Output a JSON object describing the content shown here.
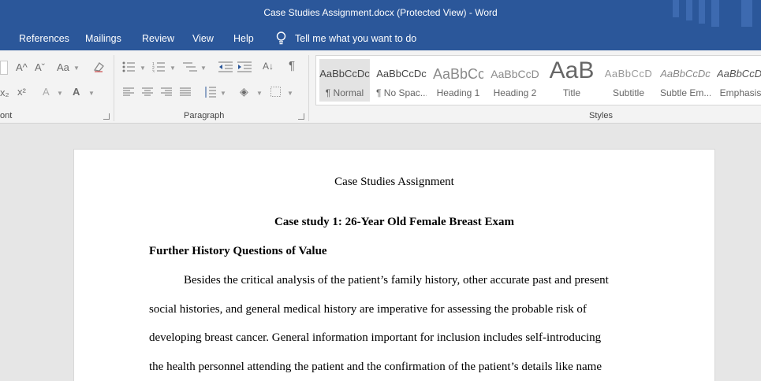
{
  "window": {
    "title": "Case Studies Assignment.docx (Protected View)  -  Word"
  },
  "tabs": [
    "References",
    "Mailings",
    "Review",
    "View",
    "Help"
  ],
  "tell_me": "Tell me what you want to do",
  "ribbon": {
    "font_group_label": "ont",
    "paragraph_group_label": "Paragraph",
    "styles_group_label": "Styles",
    "font_buttons": [
      "A^",
      "Aˇ",
      "Aa",
      "x₂",
      "x²",
      "A",
      "A"
    ],
    "styles": [
      {
        "sample": "AaBbCcDc",
        "label": "¶ Normal"
      },
      {
        "sample": "AaBbCcDc",
        "label": "¶ No Spac..."
      },
      {
        "sample": "AaBbCc",
        "label": "Heading 1"
      },
      {
        "sample": "AaBbCcD",
        "label": "Heading 2"
      },
      {
        "sample": "AaB",
        "label": "Title"
      },
      {
        "sample": "AaBbCcD",
        "label": "Subtitle"
      },
      {
        "sample": "AaBbCcDc",
        "label": "Subtle Em..."
      },
      {
        "sample": "AaBbCcDc",
        "label": "Emphasis"
      }
    ]
  },
  "document": {
    "title": "Case Studies Assignment",
    "case_heading": "Case study 1: 26-Year Old Female Breast Exam",
    "subheading": "Further History Questions of Value",
    "lines": [
      "Besides the critical analysis of the patient’s family history, other accurate past and present",
      "social histories, and general medical history are imperative for assessing the probable risk of",
      "developing breast cancer. General information important for inclusion includes self-introducing",
      "the health personnel attending the patient and the confirmation of the patient’s details like name"
    ]
  },
  "colors": {
    "brand": "#2b579a",
    "ribbon": "#f3f3f3",
    "canvas": "#e6e6e6"
  }
}
